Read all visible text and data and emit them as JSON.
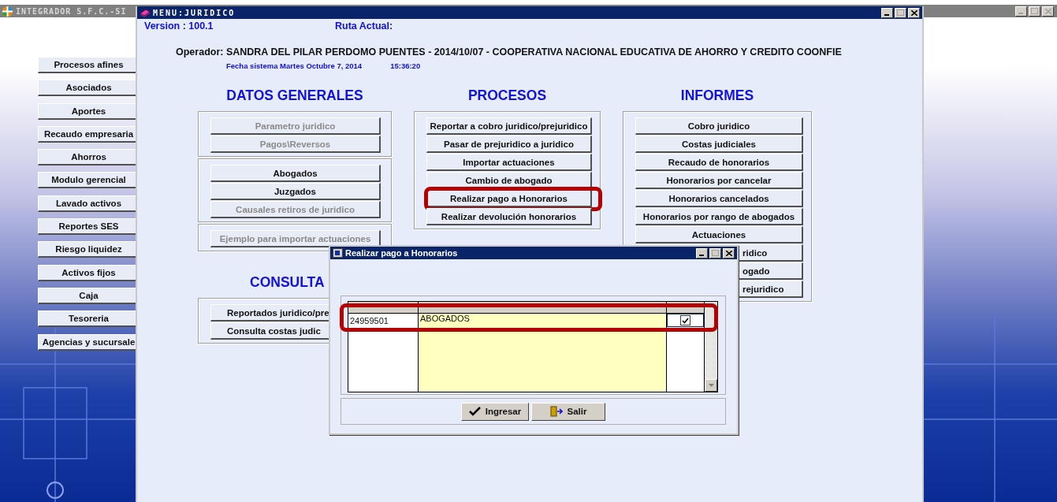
{
  "app_window": {
    "title": "INTEGRADOR S.F.C.-SI"
  },
  "sidebar": {
    "items": [
      {
        "label": "Procesos afines"
      },
      {
        "label": "Asociados"
      },
      {
        "label": "Aportes"
      },
      {
        "label": "Recaudo empresaria"
      },
      {
        "label": "Ahorros"
      },
      {
        "label": "Modulo gerencial"
      },
      {
        "label": "Lavado activos"
      },
      {
        "label": "Reportes SES"
      },
      {
        "label": "Riesgo liquidez"
      },
      {
        "label": "Activos fijos"
      },
      {
        "label": "Caja"
      },
      {
        "label": "Tesoreria"
      },
      {
        "label": "Agencias y sucursale"
      }
    ]
  },
  "main_window": {
    "title": "MENU:JURIDICO",
    "version": "Version : 100.1",
    "route_label": "Ruta Actual:",
    "operator": "Operador: SANDRA DEL PILAR PERDOMO PUENTES - 2014/10/07 - COOPERATIVA NACIONAL EDUCATIVA DE AHORRO Y CREDITO COONFIE",
    "system_date": "Fecha sistema Martes Octubre 7, 2014",
    "system_time": "15:36:20",
    "columns": [
      {
        "sections": [
          {
            "title": "DATOS GENERALES",
            "cut_right": false,
            "groups": [
              {
                "buttons": [
                  {
                    "label": "Parametro juridico",
                    "disabled": true,
                    "highlighted": false
                  },
                  {
                    "label": "Pagos\\Reversos",
                    "disabled": true,
                    "highlighted": false
                  }
                ]
              },
              {
                "buttons": [
                  {
                    "label": "Abogados",
                    "disabled": false,
                    "highlighted": false
                  },
                  {
                    "label": "Juzgados",
                    "disabled": false,
                    "highlighted": false
                  },
                  {
                    "label": "Causales retiros de juridico",
                    "disabled": true,
                    "highlighted": false
                  }
                ]
              },
              {
                "buttons": [
                  {
                    "label": "Ejemplo para importar actuaciones",
                    "disabled": true,
                    "highlighted": false
                  }
                ]
              }
            ]
          },
          {
            "title": "CONSULTA",
            "cut_right": true,
            "groups": [
              {
                "buttons": [
                  {
                    "label": "Reportados juridico/pre",
                    "disabled": false,
                    "highlighted": false,
                    "cut_right": true
                  },
                  {
                    "label": "Consulta costas judic",
                    "disabled": false,
                    "highlighted": false,
                    "cut_right": true
                  }
                ]
              }
            ]
          }
        ]
      },
      {
        "sections": [
          {
            "title": "PROCESOS",
            "cut_right": false,
            "groups": [
              {
                "buttons": [
                  {
                    "label": "Reportar a cobro juridico/prejuridico",
                    "disabled": false,
                    "highlighted": false
                  },
                  {
                    "label": "Pasar de prejuridico a juridico",
                    "disabled": false,
                    "highlighted": false
                  },
                  {
                    "label": "Importar actuaciones",
                    "disabled": false,
                    "highlighted": false
                  },
                  {
                    "label": "Cambio de abogado",
                    "disabled": false,
                    "highlighted": false
                  },
                  {
                    "label": "Realizar pago a Honorarios",
                    "disabled": false,
                    "highlighted": true
                  },
                  {
                    "label": "Realizar devolución honorarios",
                    "disabled": false,
                    "highlighted": false
                  }
                ]
              }
            ]
          }
        ]
      },
      {
        "sections": [
          {
            "title": "INFORMES",
            "cut_right": false,
            "groups": [
              {
                "buttons": [
                  {
                    "label": "Cobro juridico",
                    "disabled": false,
                    "highlighted": false
                  },
                  {
                    "label": "Costas judiciales",
                    "disabled": false,
                    "highlighted": false
                  },
                  {
                    "label": "Recaudo de honorarios",
                    "disabled": false,
                    "highlighted": false
                  },
                  {
                    "label": "Honorarios por cancelar",
                    "disabled": false,
                    "highlighted": false
                  },
                  {
                    "label": "Honorarios cancelados",
                    "disabled": false,
                    "highlighted": false
                  },
                  {
                    "label": "Honorarios por rango de abogados",
                    "disabled": false,
                    "highlighted": false
                  },
                  {
                    "label": "Actuaciones",
                    "disabled": false,
                    "highlighted": false
                  },
                  {
                    "label": "ridico",
                    "disabled": false,
                    "highlighted": false,
                    "cut_left": true
                  },
                  {
                    "label": "ogado",
                    "disabled": false,
                    "highlighted": false,
                    "cut_left": true
                  },
                  {
                    "label": "rejuridico",
                    "disabled": false,
                    "highlighted": false,
                    "cut_left": true
                  }
                ]
              }
            ]
          }
        ]
      }
    ]
  },
  "dialog": {
    "title": "Realizar pago a Honorarios",
    "table": {
      "rows": [
        {
          "column_1": "24959501",
          "column_2": "ABOGADOS",
          "checked": true,
          "highlighted": true
        }
      ]
    },
    "buttons": [
      {
        "label": "Ingresar",
        "kind": "accept"
      },
      {
        "label": "Salir",
        "kind": "exit"
      }
    ]
  }
}
